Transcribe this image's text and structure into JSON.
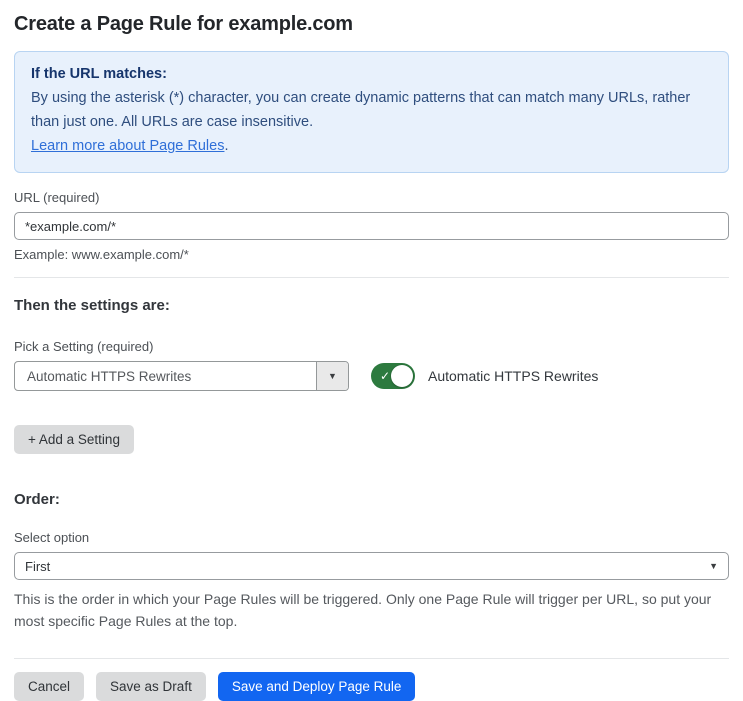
{
  "page": {
    "title": "Create a Page Rule for example.com"
  },
  "info_box": {
    "heading": "If the URL matches:",
    "body": "By using the asterisk (*) character, you can create dynamic patterns that can match many URLs, rather than just one. All URLs are case insensitive.",
    "link_label": "Learn more about Page Rules",
    "link_suffix": "."
  },
  "url_field": {
    "label": "URL (required)",
    "value": "*example.com/*",
    "helper": "Example: www.example.com/*"
  },
  "settings_section": {
    "heading": "Then the settings are:",
    "picker_label": "Pick a Setting (required)",
    "picker_value": "Automatic HTTPS Rewrites",
    "toggle_state": "on",
    "toggle_label": "Automatic HTTPS Rewrites",
    "add_setting_label": "+ Add a Setting"
  },
  "order_section": {
    "heading": "Order:",
    "select_label": "Select option",
    "select_value": "First",
    "helper": "This is the order in which your Page Rules will be triggered. Only one Page Rule will trigger per URL, so put your most specific Page Rules at the top."
  },
  "footer": {
    "cancel_label": "Cancel",
    "save_draft_label": "Save as Draft",
    "deploy_label": "Save and Deploy Page Rule"
  },
  "icons": {
    "dropdown_caret": "▼",
    "toggle_check": "✓"
  },
  "colors": {
    "accent_blue": "#1266f1",
    "info_bg": "#e8f1fc",
    "info_border": "#b8d4f2",
    "info_heading_blue": "#16356c",
    "info_text_blue": "#2f4e7e",
    "link_blue": "#2f6fd8",
    "toggle_green": "#2d7a3f",
    "button_gray": "#dadbdc"
  }
}
